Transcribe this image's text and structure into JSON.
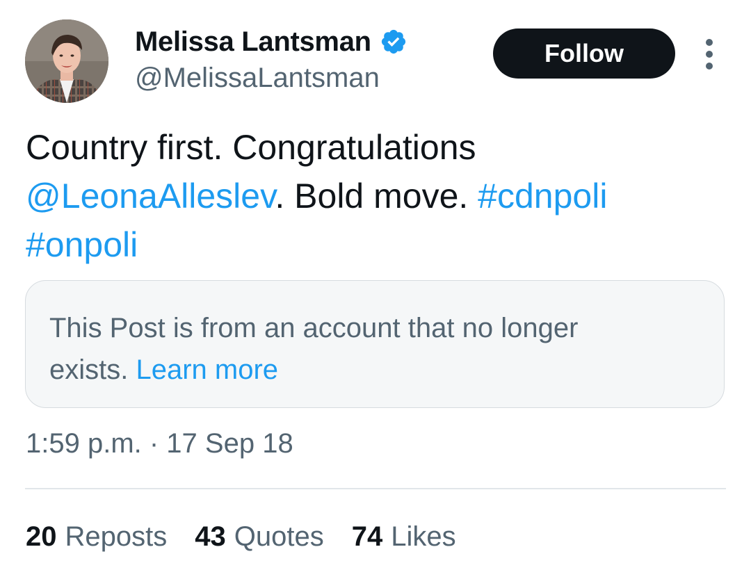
{
  "author": {
    "display_name": "Melissa Lantsman",
    "handle": "@MelissaLantsman",
    "verified": true
  },
  "follow_label": "Follow",
  "tweet": {
    "text_part1": "Country first. Congratulations",
    "mention": "@LeonaAlleslev",
    "text_part2": ". Bold move. ",
    "hashtag1": "#cdnpoli",
    "hashtag2": "#onpoli"
  },
  "notice": {
    "text_line1": "This Post is from an account that no longer",
    "text_line2": "exists. ",
    "link": "Learn more"
  },
  "timestamp": "1:59 p.m. · 17 Sep 18",
  "stats": {
    "reposts_count": "20",
    "reposts_label": "Reposts",
    "quotes_count": "43",
    "quotes_label": "Quotes",
    "likes_count": "74",
    "likes_label": "Likes"
  },
  "colors": {
    "link": "#1d9bf0",
    "text": "#0f1419",
    "secondary": "#536471",
    "button": "#0f1419"
  },
  "icons": {
    "verified": "verified-badge-icon",
    "more": "more-options-icon"
  }
}
